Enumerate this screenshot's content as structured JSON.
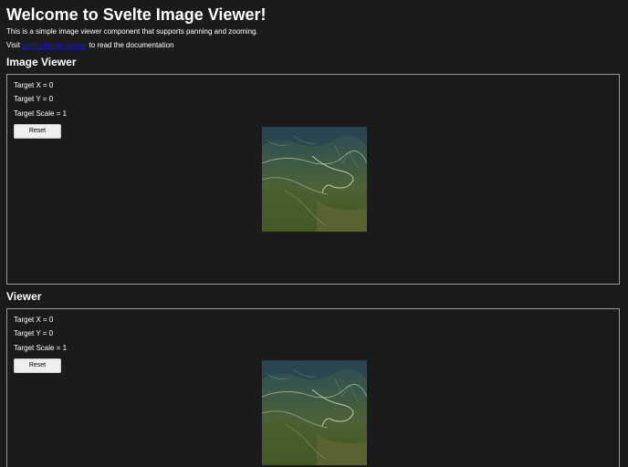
{
  "header": {
    "title": "Welcome to Svelte Image Viewer!",
    "intro": "This is a simple image viewer component that supports panning and zooming.",
    "visit_prefix": "Visit ",
    "visit_link": "svelte-image-viewer",
    "visit_suffix": " to read the documentation"
  },
  "sections": [
    {
      "heading": "Image Viewer",
      "target_x": "Target X = 0",
      "target_y": "Target Y = 0",
      "target_scale": "Target Scale = 1",
      "reset_label": "Reset",
      "image_icon": "aerial-landscape-image"
    },
    {
      "heading": "Viewer",
      "target_x": "Target X = 0",
      "target_y": "Target Y = 0",
      "target_scale": "Target Scale = 1",
      "reset_label": "Reset",
      "image_icon": "aerial-landscape-image"
    }
  ],
  "colors": {
    "background": "#1b1b1b",
    "text": "#ffffff",
    "link": "#1a0dff",
    "border": "#9a9a9a",
    "button_bg": "#efefef"
  }
}
